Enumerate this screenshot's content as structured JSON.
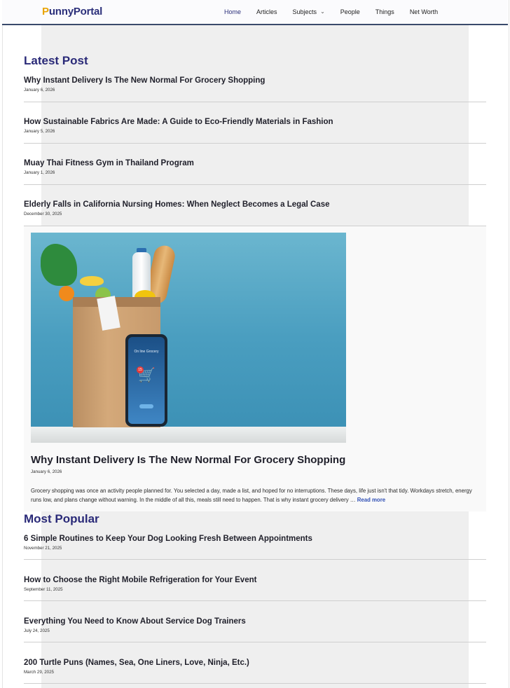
{
  "header": {
    "logo": "PunnyPortal",
    "nav": [
      {
        "label": "Home",
        "active": true
      },
      {
        "label": "Articles"
      },
      {
        "label": "Subjects",
        "has_dropdown": true
      },
      {
        "label": "People"
      },
      {
        "label": "Things"
      },
      {
        "label": "Net Worth"
      }
    ]
  },
  "latest": {
    "title": "Latest Post",
    "posts": [
      {
        "title": "Why Instant Delivery Is The New Normal For Grocery Shopping",
        "date": "January 6, 2026"
      },
      {
        "title": "How Sustainable Fabrics Are Made: A Guide to Eco-Friendly Materials in Fashion",
        "date": "January 5, 2026"
      },
      {
        "title": "Muay Thai Fitness Gym in Thailand Program",
        "date": "January 1, 2026"
      },
      {
        "title": "Elderly Falls in California Nursing Homes: When Neglect Becomes a Legal Case",
        "date": "December 30, 2025"
      }
    ]
  },
  "featured": {
    "image_alt": "Grocery bag with phone showing online grocery app",
    "screen_text": "On line Grocery",
    "badge": "15",
    "title": "Why Instant Delivery Is The New Normal For Grocery Shopping",
    "date": "January 6, 2026",
    "excerpt": "Grocery shopping was once an activity people planned for. You selected a day, made a list, and hoped for no interruptions. These days, life just isn't that tidy. Workdays stretch, energy runs low, and plans change without warning. In the middle of all this, meals still need to happen. That is why instant grocery delivery …",
    "read_more": "Read more"
  },
  "popular": {
    "title": "Most Popular",
    "posts": [
      {
        "title": "6 Simple Routines to Keep Your Dog Looking Fresh Between Appointments",
        "date": "November 21, 2025"
      },
      {
        "title": "How to Choose the Right Mobile Refrigeration for Your Event",
        "date": "September 11, 2025"
      },
      {
        "title": "Everything You Need to Know About Service Dog Trainers",
        "date": "July 24, 2025"
      },
      {
        "title": "200 Turtle Puns (Names, Sea, One Liners, Love, Ninja, Etc.)",
        "date": "March 29, 2025"
      }
    ]
  },
  "colors": {
    "brand": "#2b2f7a",
    "logo_accent": "#e9a400",
    "link": "#2f4fb5"
  }
}
